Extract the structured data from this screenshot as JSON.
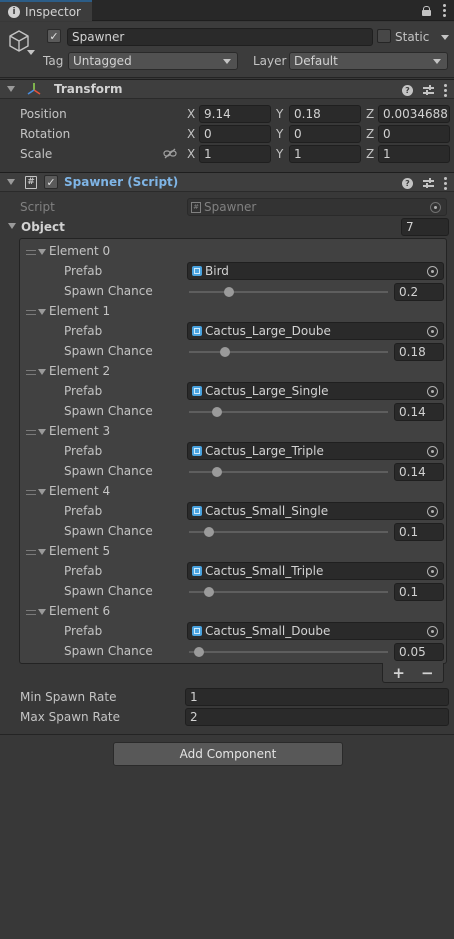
{
  "window": {
    "tab_title": "Inspector"
  },
  "game_object": {
    "name": "Spawner",
    "active": true,
    "static_label": "Static",
    "static_checked": false,
    "tag_label": "Tag",
    "tag_value": "Untagged",
    "layer_label": "Layer",
    "layer_value": "Default"
  },
  "transform": {
    "title": "Transform",
    "rows": [
      {
        "label": "Position",
        "x": "9.14",
        "y": "0.18",
        "z": "0.0034688"
      },
      {
        "label": "Rotation",
        "x": "0",
        "y": "0",
        "z": "0"
      },
      {
        "label": "Scale",
        "x": "1",
        "y": "1",
        "z": "1"
      }
    ],
    "axes": {
      "x": "X",
      "y": "Y",
      "z": "Z"
    }
  },
  "spawner": {
    "title": "Spawner (Script)",
    "enabled": true,
    "script_label": "Script",
    "script_value": "Spawner",
    "object_label": "Object",
    "object_count": "7",
    "prefab_label": "Prefab",
    "chance_label": "Spawn Chance",
    "elements": [
      {
        "label": "Element 0",
        "prefab": "Bird",
        "chance": "0.2",
        "chance_value": 0.2
      },
      {
        "label": "Element 1",
        "prefab": "Cactus_Large_Doube",
        "chance": "0.18",
        "chance_value": 0.18
      },
      {
        "label": "Element 2",
        "prefab": "Cactus_Large_Single",
        "chance": "0.14",
        "chance_value": 0.14
      },
      {
        "label": "Element 3",
        "prefab": "Cactus_Large_Triple",
        "chance": "0.14",
        "chance_value": 0.14
      },
      {
        "label": "Element 4",
        "prefab": "Cactus_Small_Single",
        "chance": "0.1",
        "chance_value": 0.1
      },
      {
        "label": "Element 5",
        "prefab": "Cactus_Small_Triple",
        "chance": "0.1",
        "chance_value": 0.1
      },
      {
        "label": "Element 6",
        "prefab": "Cactus_Small_Doube",
        "chance": "0.05",
        "chance_value": 0.05
      }
    ],
    "list_add": "+",
    "list_remove": "−",
    "min_rate_label": "Min Spawn Rate",
    "min_rate": "1",
    "max_rate_label": "Max Spawn Rate",
    "max_rate": "2"
  },
  "add_component_label": "Add Component",
  "colors": {
    "tab_accent": "#2c5d87",
    "script_title": "#7fb5e6",
    "prefab_icon": "#4aa3df"
  }
}
